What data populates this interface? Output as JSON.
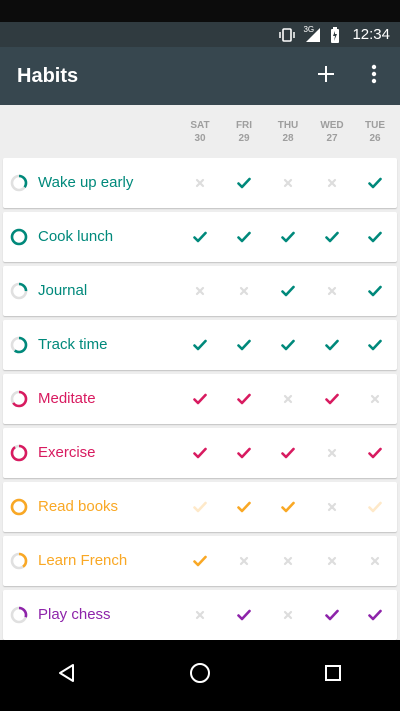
{
  "status_bar": {
    "time": "12:34",
    "network": "3G",
    "icons": [
      "vibrate-icon",
      "signal-icon",
      "battery-icon"
    ]
  },
  "app_bar": {
    "title": "Habits",
    "actions": [
      "add-icon",
      "overflow-menu-icon"
    ]
  },
  "days": [
    {
      "name": "SAT",
      "date": "30"
    },
    {
      "name": "FRI",
      "date": "29"
    },
    {
      "name": "THU",
      "date": "28"
    },
    {
      "name": "WED",
      "date": "27"
    },
    {
      "name": "TUE",
      "date": "26"
    }
  ],
  "habits": [
    {
      "name": "Wake up early",
      "color": "#00897b",
      "score": 0.35,
      "checks": [
        false,
        true,
        false,
        false,
        true
      ]
    },
    {
      "name": "Cook lunch",
      "color": "#00897b",
      "score": 1.0,
      "checks": [
        true,
        true,
        true,
        true,
        true
      ]
    },
    {
      "name": "Journal",
      "color": "#00897b",
      "score": 0.25,
      "checks": [
        false,
        false,
        true,
        false,
        true
      ]
    },
    {
      "name": "Track time",
      "color": "#00897b",
      "score": 0.6,
      "checks": [
        true,
        true,
        true,
        true,
        true
      ]
    },
    {
      "name": "Meditate",
      "color": "#d81b60",
      "score": 0.65,
      "checks": [
        true,
        true,
        false,
        true,
        false
      ]
    },
    {
      "name": "Exercise",
      "color": "#d81b60",
      "score": 0.9,
      "checks": [
        true,
        true,
        true,
        false,
        true
      ]
    },
    {
      "name": "Read books",
      "color": "#f9a825",
      "score": 1.0,
      "checks": [
        true,
        true,
        true,
        false,
        true
      ],
      "faded": [
        true,
        false,
        false,
        false,
        true
      ]
    },
    {
      "name": "Learn French",
      "color": "#f9a825",
      "score": 0.4,
      "checks": [
        true,
        false,
        false,
        false,
        false
      ]
    },
    {
      "name": "Play chess",
      "color": "#8e24aa",
      "score": 0.3,
      "checks": [
        false,
        true,
        false,
        true,
        true
      ]
    }
  ],
  "colors": {
    "teal": "#00897b",
    "pink": "#d81b60",
    "amber": "#f9a825",
    "purple": "#8e24aa",
    "unchecked": "#dddddd",
    "app_bar": "#37474f"
  },
  "nav_bar": {
    "buttons": [
      "back-icon",
      "home-icon",
      "recents-icon"
    ]
  }
}
